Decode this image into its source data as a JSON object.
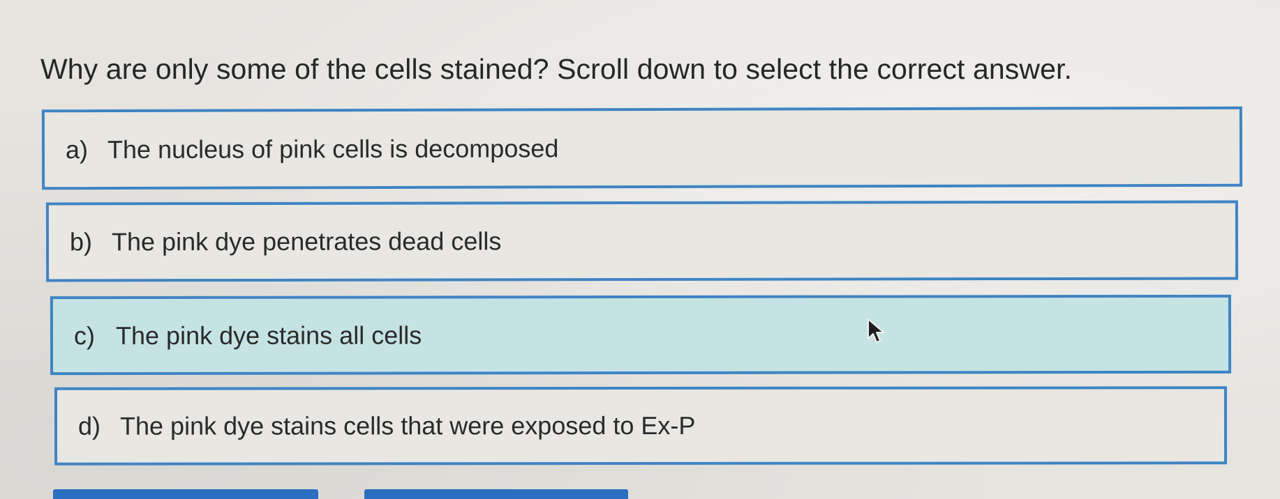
{
  "question": {
    "text": "Why are only some of the cells stained? Scroll down to select the correct answer."
  },
  "options": [
    {
      "letter": "a)",
      "text": "The nucleus of pink cells is decomposed",
      "highlighted": false
    },
    {
      "letter": "b)",
      "text": "The pink dye penetrates dead cells",
      "highlighted": false
    },
    {
      "letter": "c)",
      "text": "The pink dye stains all cells",
      "highlighted": true
    },
    {
      "letter": "d)",
      "text": "The pink dye stains cells that were exposed to Ex-P",
      "highlighted": false
    }
  ],
  "colors": {
    "border": "#3f84c4",
    "highlight_background": "#c6e3e3",
    "page_background": "#e6e4df",
    "button": "#2b6fc0"
  },
  "icons": {
    "cursor": "mouse-pointer-icon"
  }
}
